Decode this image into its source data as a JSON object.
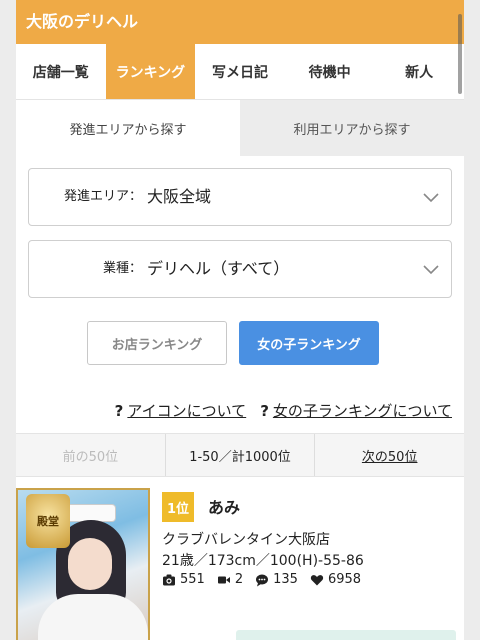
{
  "header": {
    "title": "大阪のデリヘル"
  },
  "tabs": [
    {
      "label": "店舗一覧",
      "active": false
    },
    {
      "label": "ランキング",
      "active": true
    },
    {
      "label": "写メ日記",
      "active": false
    },
    {
      "label": "待機中",
      "active": false
    },
    {
      "label": "新人",
      "active": false
    }
  ],
  "search_tabs": [
    {
      "label": "発進エリアから探す",
      "active": true
    },
    {
      "label": "利用エリアから探す",
      "active": false
    }
  ],
  "filters": {
    "area": {
      "label": "発進エリア：",
      "value": "大阪全域"
    },
    "category": {
      "label": "業種：",
      "value": "デリヘル（すべて）"
    }
  },
  "ranking_buttons": {
    "shop": "お店ランキング",
    "girl": "女の子ランキング"
  },
  "help_links": {
    "icon": {
      "q": "?",
      "text": "アイコンについて"
    },
    "ranking": {
      "q": "?",
      "text": "女の子ランキングについて"
    }
  },
  "pager": {
    "prev": "前の50位",
    "info": "1-50／計1000位",
    "next": "次の50位"
  },
  "ranking_list": [
    {
      "rank": "1位",
      "name": "あみ",
      "shop": "クラブバレンタイン大阪店",
      "profile": "21歳／173cm／100(H)-55-86",
      "stats": {
        "photos": "551",
        "videos": "2",
        "comments": "135",
        "likes": "6958"
      },
      "badge": "殿堂"
    }
  ],
  "colors": {
    "accent": "#efaa46",
    "button_blue": "#4a90e2",
    "rank_gold": "#efbb2a"
  },
  "icons": [
    "chevron-down-icon",
    "question-icon",
    "camera-icon",
    "video-icon",
    "comment-icon",
    "heart-icon"
  ]
}
